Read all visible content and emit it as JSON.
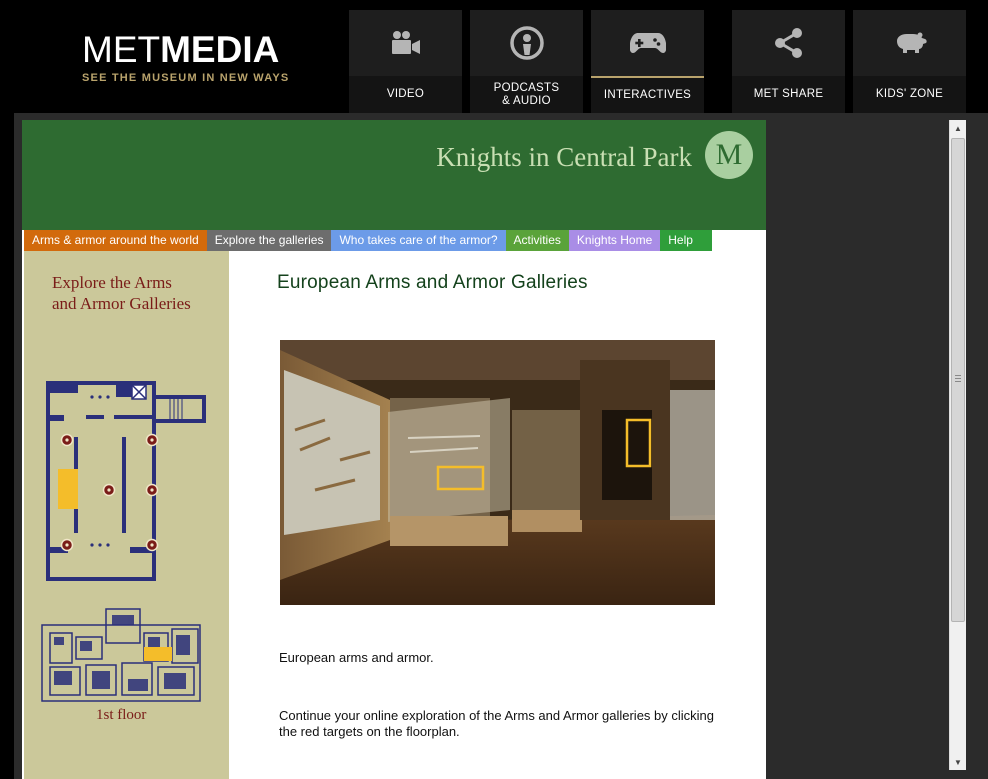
{
  "header": {
    "brand_light": "MET",
    "brand_bold": "MEDIA",
    "tagline": "SEE THE MUSEUM IN NEW WAYS",
    "nav": [
      {
        "label": "VIDEO",
        "icon": "video-camera-icon"
      },
      {
        "label": "PODCASTS\n& AUDIO",
        "icon": "podcast-icon"
      },
      {
        "label": "INTERACTIVES",
        "icon": "gamepad-icon",
        "active": true
      },
      {
        "label": "MET SHARE",
        "icon": "share-icon"
      },
      {
        "label": "KIDS' ZONE",
        "icon": "bear-icon"
      }
    ]
  },
  "banner": {
    "title": "Knights in Central Park",
    "monogram": "M"
  },
  "tabs": [
    {
      "label": "Arms & armor around the world",
      "color": "#d26a0c"
    },
    {
      "label": "Explore the galleries",
      "color": "#6d6d6d"
    },
    {
      "label": "Who takes care of the armor?",
      "color": "#6c9be8"
    },
    {
      "label": "Activities",
      "color": "#5aa33a"
    },
    {
      "label": "Knights Home",
      "color": "#a98de6"
    },
    {
      "label": "Help",
      "color": "#2f9e3a"
    }
  ],
  "sidebar": {
    "title_line1": "Explore the Arms",
    "title_line2": "and Armor Galleries",
    "floor_label": "1st floor"
  },
  "main": {
    "heading": "European Arms and Armor Galleries",
    "caption": "European arms and armor.",
    "instructions": "Continue your online exploration of the Arms and Armor galleries by clicking the red targets on the floorplan."
  },
  "colors": {
    "banner_green": "#2e6b31",
    "sidebar_tan": "#cbc89a",
    "floorplan_navy": "#2a2f7a",
    "highlight_yellow": "#f4bd2a",
    "target_red": "#7a1c18",
    "accent_gold": "#b9a36c"
  }
}
